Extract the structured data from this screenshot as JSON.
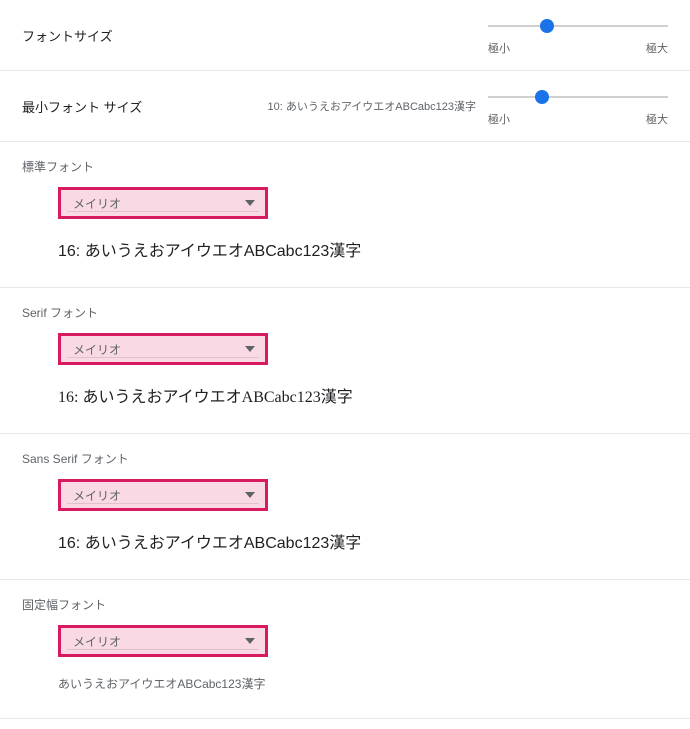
{
  "slider": {
    "font_size": {
      "label": "フォントサイズ",
      "min_label": "極小",
      "max_label": "極大",
      "thumb_percent": 33
    },
    "min_font_size": {
      "label": "最小フォント サイズ",
      "middle_sample": "10: あいうえおアイウエオABCabc123漢字",
      "min_label": "極小",
      "max_label": "極大",
      "thumb_percent": 30
    }
  },
  "sections": {
    "standard": {
      "title": "標準フォント",
      "value": "メイリオ",
      "preview": "16: あいうえおアイウエオABCabc123漢字"
    },
    "serif": {
      "title": "Serif フォント",
      "value": "メイリオ",
      "preview": "16: あいうえおアイウエオABCabc123漢字"
    },
    "sans": {
      "title": "Sans Serif フォント",
      "value": "メイリオ",
      "preview": "16: あいうえおアイウエオABCabc123漢字"
    },
    "fixed": {
      "title": "固定幅フォント",
      "value": "メイリオ",
      "preview": "あいうえおアイウエオABCabc123漢字"
    }
  },
  "colors": {
    "highlight_border": "#d81b60",
    "highlight_fill": "#f9d9e4",
    "thumb": "#1a73e8"
  }
}
